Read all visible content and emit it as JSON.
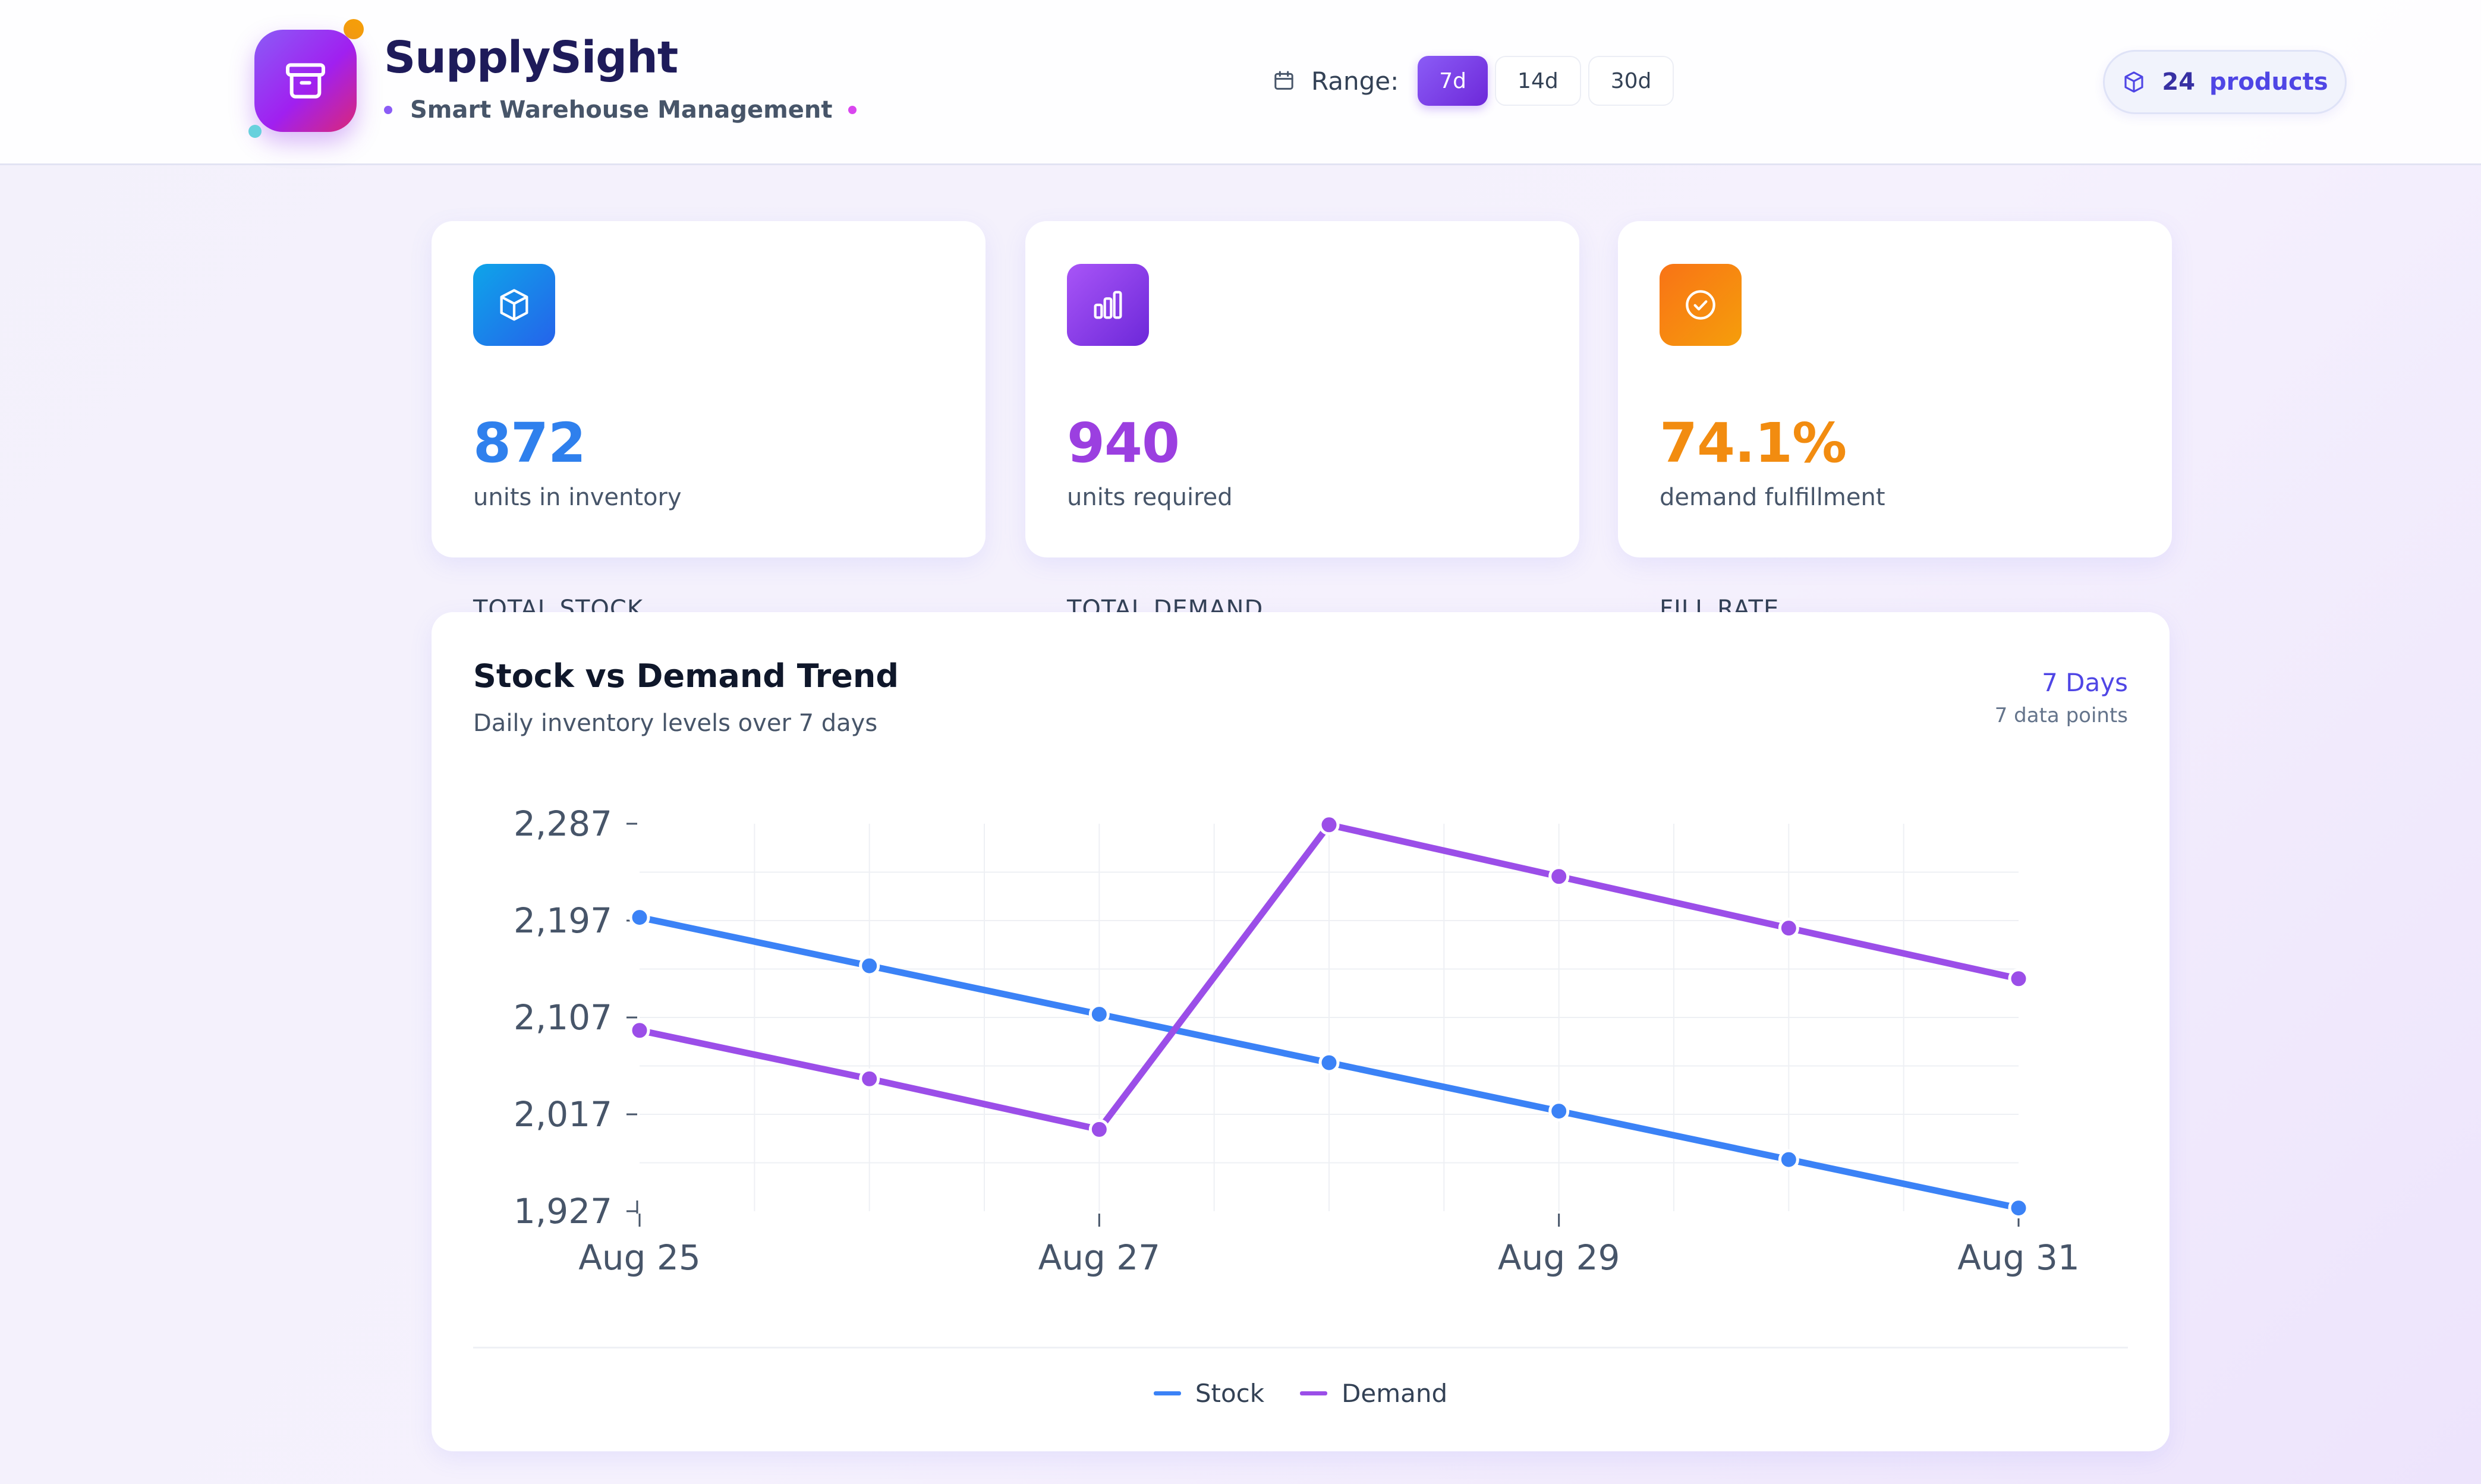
{
  "header": {
    "brand_title": "SupplySight",
    "brand_subtitle": "Smart Warehouse Management",
    "range_label": "Range:",
    "range_options": [
      "7d",
      "14d",
      "30d"
    ],
    "range_selected": "7d",
    "products_count": "24",
    "products_label": "products",
    "icons": {
      "logo": "archive-box-icon",
      "calendar": "calendar-icon",
      "products": "cube-icon"
    }
  },
  "kpis": [
    {
      "label": "TOTAL STOCK",
      "value": "872",
      "sub": "units in inventory",
      "icon": "cube-icon",
      "color": "#2f80ed",
      "gradient": [
        "#0ea5e9",
        "#2563eb"
      ]
    },
    {
      "label": "TOTAL DEMAND",
      "value": "940",
      "sub": "units required",
      "icon": "bar-chart-icon",
      "color": "#9b3fe0",
      "gradient": [
        "#a855f7",
        "#6d28d9"
      ]
    },
    {
      "label": "FILL RATE",
      "value": "74.1%",
      "sub": "demand fulfillment",
      "icon": "check-circle-icon",
      "color": "#f28c10",
      "gradient": [
        "#f97316",
        "#f59e0b"
      ]
    }
  ],
  "chart": {
    "title": "Stock vs Demand Trend",
    "subtitle": "Daily inventory levels over 7 days",
    "range_label": "7 Days",
    "points_label": "7 data points"
  },
  "chart_data": {
    "type": "line",
    "x": [
      "Aug 25",
      "Aug 26",
      "Aug 27",
      "Aug 28",
      "Aug 29",
      "Aug 30",
      "Aug 31"
    ],
    "x_tick_labels": [
      "Aug 25",
      "Aug 27",
      "Aug 29",
      "Aug 31"
    ],
    "y_ticks": [
      "2,287",
      "2,197",
      "2,107",
      "2,017",
      "1,927"
    ],
    "ylim": [
      1927,
      2287
    ],
    "grid": true,
    "legend_position": "bottom-center",
    "series": [
      {
        "name": "Stock",
        "color": "#3b82f6",
        "values": [
          2200,
          2155,
          2110,
          2065,
          2020,
          1975,
          1930
        ]
      },
      {
        "name": "Demand",
        "color": "#9b4ee8",
        "values": [
          2095,
          2050,
          2003,
          2286,
          2238,
          2190,
          2143
        ]
      }
    ]
  }
}
